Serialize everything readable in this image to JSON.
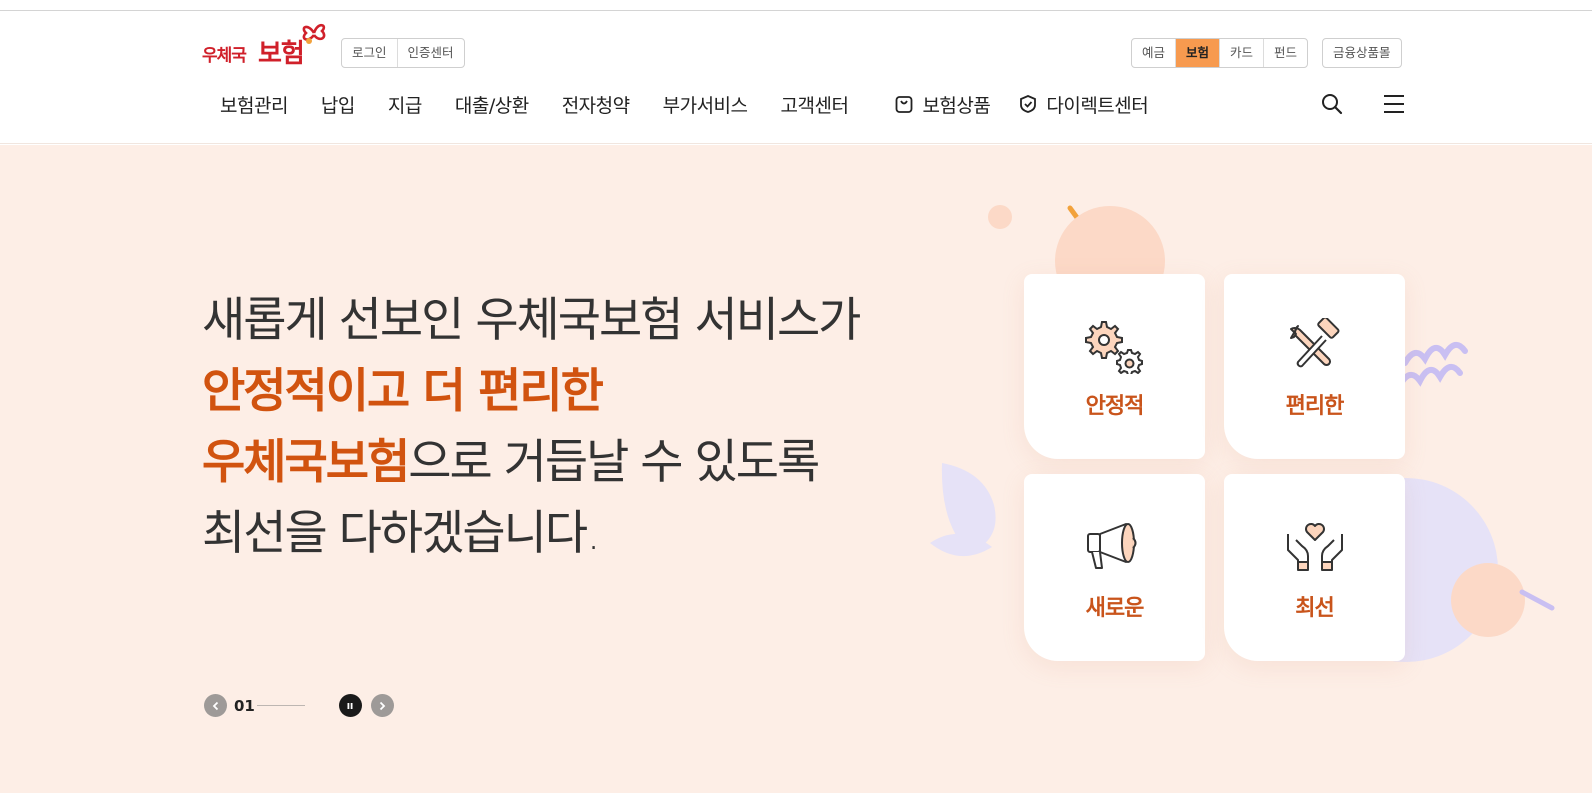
{
  "header": {
    "logo": {
      "text_small": "우체국",
      "text_large": "보험"
    },
    "login_buttons": [
      {
        "label": "로그인"
      },
      {
        "label": "인증센터"
      }
    ],
    "service_tabs": [
      {
        "label": "예금",
        "active": false
      },
      {
        "label": "보험",
        "active": true
      },
      {
        "label": "카드",
        "active": false
      },
      {
        "label": "펀드",
        "active": false
      }
    ],
    "finance_mall": {
      "label": "금융상품몰"
    },
    "nav": [
      {
        "label": "보험관리"
      },
      {
        "label": "납입"
      },
      {
        "label": "지급"
      },
      {
        "label": "대출/상환"
      },
      {
        "label": "전자청약"
      },
      {
        "label": "부가서비스"
      },
      {
        "label": "고객센터"
      }
    ],
    "nav_special": [
      {
        "label": "보험상품",
        "icon": "shopping-bag-icon"
      },
      {
        "label": "다이렉트센터",
        "icon": "shield-check-icon"
      }
    ]
  },
  "hero": {
    "line1": "새롭게 선보인 우체국보험 서비스가",
    "line2_accent": "안정적이고 더 편리한",
    "line3_accent": "우체국보험",
    "line3_rest": "으로 거듭날 수 있도록",
    "line4": "최선을 다하겠습니다.",
    "cards": [
      {
        "label": "안정적",
        "icon": "gears-icon"
      },
      {
        "label": "편리한",
        "icon": "tools-icon"
      },
      {
        "label": "새로운",
        "icon": "megaphone-icon"
      },
      {
        "label": "최선",
        "icon": "hands-heart-icon"
      }
    ],
    "pager": {
      "current": "01"
    }
  },
  "colors": {
    "accent": "#d1530f",
    "logo_red": "#d0202a",
    "active_tab": "#f79a4f",
    "hero_bg": "#fdeee6",
    "deco_lavender": "#e6e2f7",
    "deco_peach": "#fcd9c7"
  }
}
